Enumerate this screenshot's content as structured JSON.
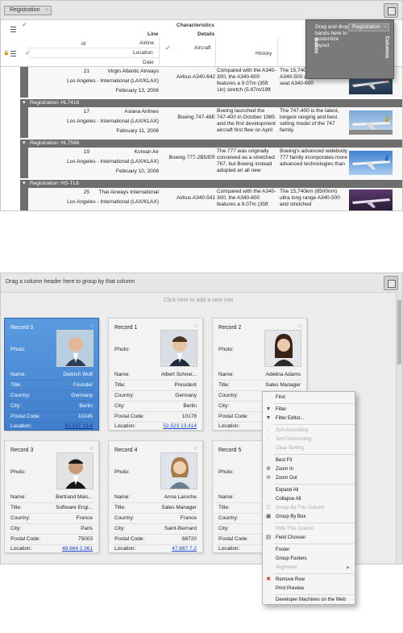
{
  "top_grid": {
    "group_chip": "Registration",
    "headers": {
      "characteristics": "Characteristics",
      "line": "Line",
      "details": "Details",
      "id": "id",
      "airline": "Airline",
      "location": "Location",
      "date": "Date",
      "aircraft": "Aircraft",
      "history": "History"
    },
    "customize": {
      "drag_text": "Drag and drop bands here to customize layout",
      "bands": "Bands",
      "columns": "Columns",
      "chip": "Registration"
    },
    "rows": [
      {
        "group": "",
        "id": "21",
        "airline": "Virgin Atlantic Airways",
        "location": "Los Angeles - International (LAX/KLAX)",
        "date": "February 13, 2008",
        "aircraft": "Airbus A340-642",
        "history": "Compared with the A340-300, the A340-600 features a 9.07m (35ft 1in) stretch (5.87m/19ft",
        "desc": "The 15,740 ultra long range A340-500 and stretched 372 seat A340-600"
      },
      {
        "group": "Registration: HL7418",
        "id": "17",
        "airline": "Asiana Airlines",
        "location": "Los Angeles - International (LAX/KLAX)",
        "date": "February 11, 2008",
        "aircraft": "Boeing 747-48E",
        "history": "Boeing launched the 747-400 in October 1985 and the first development aircraft first flew on April",
        "desc": "The 747-400 is the latest, longest ranging and best selling model of the 747 family."
      },
      {
        "group": "Registration: HL7598",
        "id": "19",
        "airline": "Korean Air",
        "location": "Los Angeles - International (LAX/KLAX)",
        "date": "February 10, 2008",
        "aircraft": "Boeing 777-2B5/ER",
        "history": "The 777 was originally conceived as a stretched 767, but Boeing instead adopted an all new",
        "desc": "Boeing's advanced widebody 777 family incorporates more advanced technologies than"
      },
      {
        "group": "Registration: HS-TL8",
        "id": "25",
        "airline": "Thai Airways International",
        "location": "Los Angeles - International (LAX/KLAX)",
        "date": "",
        "aircraft": "Airbus A340-541",
        "history": "Compared with the A340-300, the A340-600 features a 9.07m (35ft",
        "desc": "The 15,740km (8500nm) ultra long range A340-500 and stretched"
      }
    ]
  },
  "bottom_view": {
    "group_panel_text": "Drag a column header here to group by that column",
    "new_row_text": "Click here to add a new row",
    "labels": {
      "photo": "Photo:",
      "name": "Name:",
      "title": "Title:",
      "country": "Country:",
      "city": "City:",
      "postal": "Postal Code:",
      "location": "Location:"
    },
    "cards": [
      {
        "record": "Record 0",
        "name": "Dietrich Wolf",
        "title": "Founder",
        "country": "Germany",
        "city": "Berlin",
        "postal": "10245",
        "location": "52.517  13.4",
        "selected": true
      },
      {
        "record": "Record 1",
        "name": "Albert Schnei...",
        "title": "President",
        "country": "Germany",
        "city": "Berlin",
        "postal": "10178",
        "location": "52.523  13.414",
        "selected": false
      },
      {
        "record": "Record 2",
        "name": "Adelina Adams",
        "title": "Sales Manager",
        "country": "",
        "city": "",
        "postal": "",
        "location": "",
        "selected": false
      },
      {
        "record": "Record 3",
        "name": "Bertrand Mais...",
        "title": "Software Engi...",
        "country": "France",
        "city": "Paris",
        "postal": "75003",
        "location": "48.864  2.361",
        "selected": false
      },
      {
        "record": "Record 4",
        "name": "Anna Laroche",
        "title": "Sales Manager",
        "country": "France",
        "city": "Saint-Bernard",
        "postal": "68720",
        "location": "47.667  7.2",
        "selected": false
      },
      {
        "record": "Record 5",
        "name": "",
        "title": "",
        "country": "",
        "city": "",
        "postal": "",
        "location": "",
        "selected": false
      }
    ]
  },
  "context_menu": {
    "items": {
      "find": "Find",
      "filter": "Filter",
      "filter_editor": "Filter Editor...",
      "sort_asc": "Sort Ascending",
      "sort_desc": "Sort Descending",
      "clear_sorting": "Clear Sorting",
      "best_fit": "Best Fit",
      "zoom_in": "Zoom In",
      "zoom_out": "Zoom Out",
      "expand_all": "Expand All",
      "collapse_all": "Collapse All",
      "group_by_column": "Group By This Column",
      "group_by_box": "Group By Box",
      "hide_column": "Hide This Column",
      "field_chooser": "Field Chooser",
      "footer": "Footer",
      "group_footers": "Group Footers",
      "alignment": "Alignment",
      "remove_row": "Remove Row",
      "print_preview": "Print Preview",
      "developer_machines": "Developer Machines on the Web"
    }
  }
}
